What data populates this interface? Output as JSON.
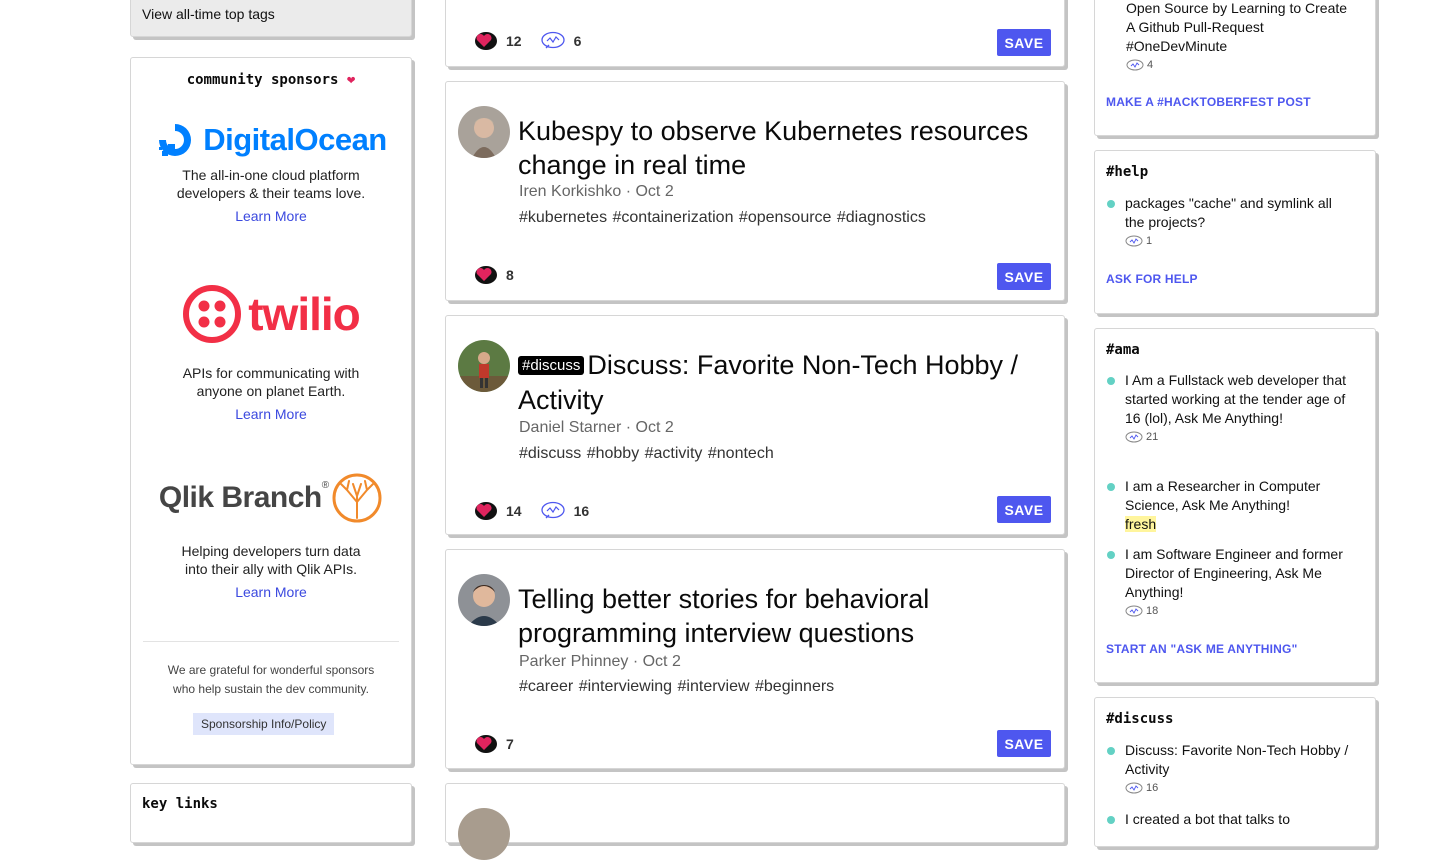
{
  "left": {
    "top_tags_link": "View all-time top tags",
    "sponsors_heading": "community sponsors",
    "heart": "❤",
    "sponsors": [
      {
        "name": "DigitalOcean",
        "desc_line1": "The all-in-one cloud platform",
        "desc_line2": "developers & their teams love.",
        "cta": "Learn More"
      },
      {
        "name": "twilio",
        "desc_line1": "APIs for communicating with",
        "desc_line2": "anyone on planet Earth.",
        "cta": "Learn More"
      },
      {
        "name": "Qlik Branch",
        "desc_line1": "Helping developers turn data",
        "desc_line2": "into their ally with Qlik APIs.",
        "cta": "Learn More"
      }
    ],
    "grateful_line1": "We are grateful for wonderful sponsors",
    "grateful_line2": "who help sustain the dev community.",
    "policy_link": "Sponsorship Info/Policy",
    "key_links_heading": "key links"
  },
  "posts": [
    {
      "reactions": "12",
      "comments": "6",
      "save": "SAVE"
    },
    {
      "title": "Kubespy to observe Kubernetes resources change in real time",
      "author": "Iren Korkishko",
      "date": "Oct 2",
      "tags": "#kubernetes #containerization #opensource #diagnostics",
      "reactions": "8",
      "save": "SAVE"
    },
    {
      "badge": "#discuss",
      "title": "Discuss: Favorite Non-Tech Hobby / Activity",
      "author": "Daniel Starner",
      "date": "Oct 2",
      "tags": "#discuss #hobby #activity #nontech",
      "reactions": "14",
      "comments": "16",
      "save": "SAVE"
    },
    {
      "title": "Telling better stories for behavioral programming interview questions",
      "author": "Parker Phinney",
      "date": "Oct 2",
      "tags": "#career #interviewing #interview #beginners",
      "reactions": "7",
      "save": "SAVE"
    }
  ],
  "right": {
    "hacktoberfest": {
      "item_text": "Open Source by Learning to Create A Github Pull-Request #OneDevMinute",
      "comments": "4",
      "cta": "MAKE A #HACKTOBERFEST POST"
    },
    "help": {
      "heading": "#help",
      "items": [
        {
          "text": "packages \"cache\" and symlink all the projects?",
          "comments": "1"
        }
      ],
      "cta": "ASK FOR HELP"
    },
    "ama": {
      "heading": "#ama",
      "items": [
        {
          "text": "I Am a Fullstack web developer that started working at the tender age of 16 (lol), Ask Me Anything!",
          "comments": "21"
        },
        {
          "text": "I am a Researcher in Computer Science, Ask Me Anything!",
          "badge": "fresh"
        },
        {
          "text": "I am Software Engineer and former Director of Engineering, Ask Me Anything!",
          "comments": "18"
        }
      ],
      "cta": "START AN \"ASK ME ANYTHING\""
    },
    "discuss": {
      "heading": "#discuss",
      "items": [
        {
          "text": "Discuss: Favorite Non-Tech Hobby / Activity",
          "comments": "16"
        },
        {
          "text": "I created a bot that talks to"
        }
      ]
    }
  },
  "colors": {
    "accent": "#4e57ef",
    "heart": "#e0245e",
    "dot": "#63d1c4",
    "fresh": "#fff59d"
  }
}
